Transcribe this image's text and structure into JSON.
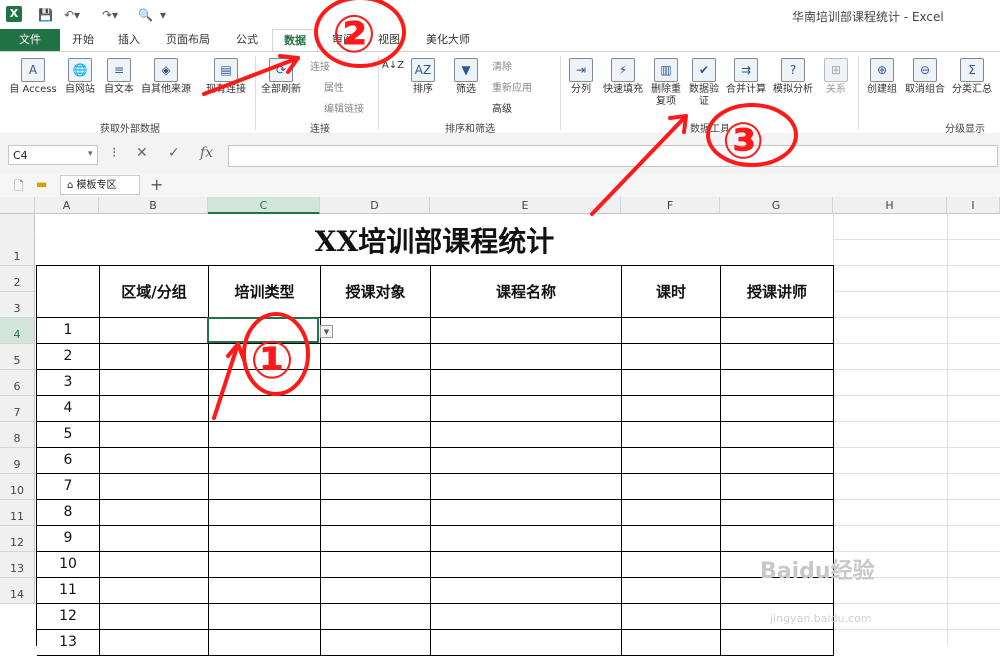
{
  "window": {
    "title": "华南培训部课程统计 - Excel",
    "app_icon": "X"
  },
  "tabs": [
    {
      "label": "文件",
      "kind": "file"
    },
    {
      "label": "开始"
    },
    {
      "label": "插入"
    },
    {
      "label": "页面布局"
    },
    {
      "label": "公式"
    },
    {
      "label": "数据",
      "active": true
    },
    {
      "label": "审阅"
    },
    {
      "label": "视图"
    },
    {
      "label": "美化大师"
    }
  ],
  "ribbon": {
    "get_external": {
      "group": "获取外部数据",
      "buttons": [
        "自 Access",
        "自网站",
        "自文本",
        "自其他来源",
        "现有连接"
      ]
    },
    "connections": {
      "group": "连接",
      "refresh_all": "全部刷新",
      "items": [
        "连接",
        "属性",
        "编辑链接"
      ]
    },
    "sort_filter": {
      "group": "排序和筛选",
      "sort": "排序",
      "filter": "筛选",
      "items": [
        "清除",
        "重新应用",
        "高级"
      ]
    },
    "data_tools": {
      "group": "数据工具",
      "buttons": [
        "分列",
        "快速填充",
        "删除重复项",
        "数据验证",
        "合并计算",
        "模拟分析",
        "关系"
      ]
    },
    "outline": {
      "group": "分级显示",
      "buttons": [
        "创建组",
        "取消组合",
        "分类汇总"
      ]
    }
  },
  "formula_bar": {
    "name_box": "C4",
    "fx": "fx",
    "value": ""
  },
  "sheet_tabs": {
    "template": "模板专区",
    "add": "+"
  },
  "columns": [
    "A",
    "B",
    "C",
    "D",
    "E",
    "F",
    "G",
    "H",
    "I"
  ],
  "rows": [
    "1",
    "2",
    "3",
    "4",
    "5",
    "6",
    "7",
    "8",
    "9",
    "10",
    "11",
    "12",
    "13",
    "14"
  ],
  "sheet": {
    "title": "XX培训部课程统计",
    "headers": [
      "区域/分组",
      "培训类型",
      "授课对象",
      "课程名称",
      "课时",
      "授课讲师"
    ],
    "numbers": [
      "1",
      "2",
      "3",
      "4",
      "5",
      "6",
      "7",
      "8",
      "9",
      "10",
      "11",
      "12",
      "13"
    ]
  },
  "annotations": {
    "step1": "①",
    "step2": "②",
    "step3": "③",
    "color": "#ff1a1a"
  },
  "watermark": {
    "brand": "Baidu经验",
    "url": "jingyan.baidu.com"
  }
}
